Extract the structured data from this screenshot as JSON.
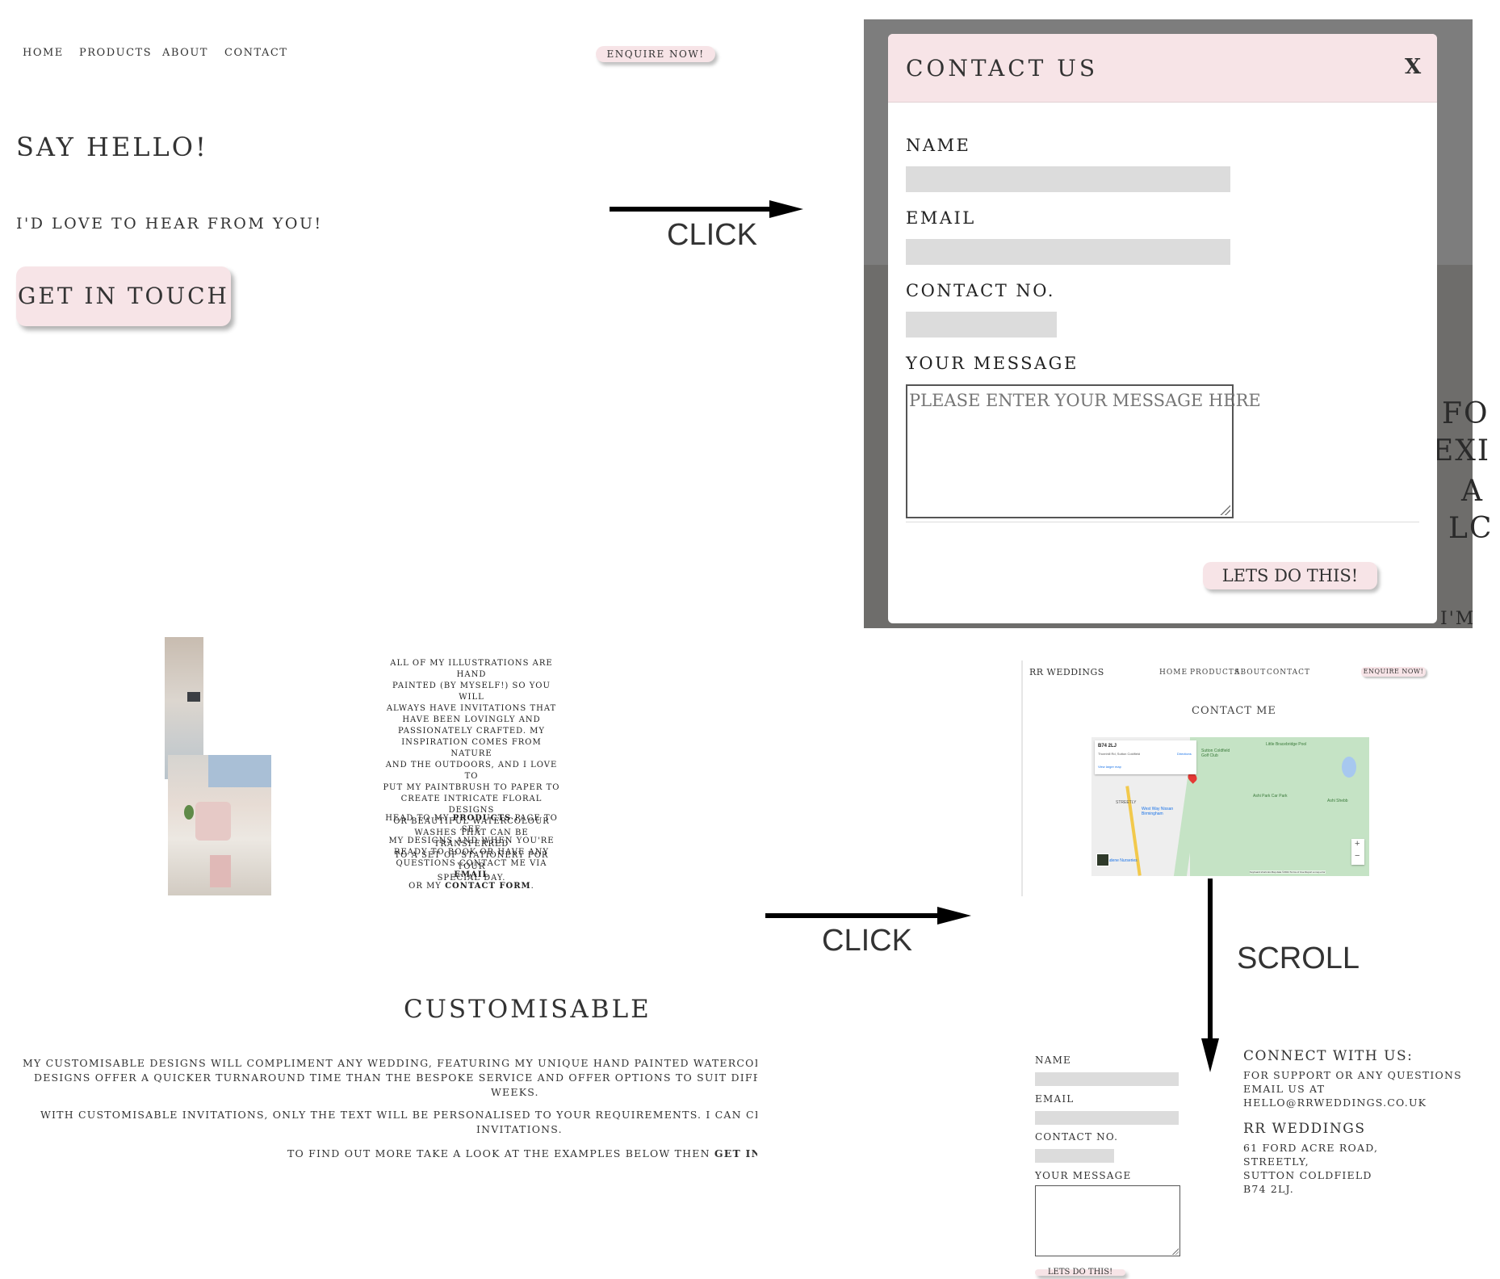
{
  "panel1": {
    "nav": [
      "HOME",
      "PRODUCTS",
      "ABOUT",
      "CONTACT"
    ],
    "enquire_button": "ENQUIRE NOW!",
    "heading": "SAY HELLO!",
    "subheading": "I'D LOVE TO HEAR FROM YOU!",
    "cta_button": "GET IN TOUCH"
  },
  "annotations": {
    "click_1": "CLICK",
    "click_2": "CLICK",
    "scroll": "SCROLL"
  },
  "modal": {
    "title": "CONTACT US",
    "close": "X",
    "name_label": "NAME",
    "email_label": "EMAIL",
    "phone_label": "CONTACT NO.",
    "message_label": "YOUR MESSAGE",
    "message_placeholder": "PLEASE ENTER YOUR MESSAGE HERE",
    "submit": "LETS DO THIS!",
    "background_fragments": [
      "FO",
      "EXI",
      "A",
      "LC",
      "I'M"
    ]
  },
  "panel3": {
    "about_paragraph_1": [
      "ALL OF MY ILLUSTRATIONS ARE HAND",
      "PAINTED (BY MYSELF!) SO YOU WILL",
      "ALWAYS HAVE INVITATIONS THAT",
      "HAVE BEEN LOVINGLY AND",
      "PASSIONATELY CRAFTED. MY",
      "INSPIRATION COMES FROM NATURE",
      "AND THE OUTDOORS, AND I LOVE TO",
      "PUT MY PAINTBRUSH TO PAPER TO",
      "CREATE INTRICATE FLORAL DESIGNS",
      "OR BEAUTIFUL WATERCOLOUR",
      "WASHES THAT CAN BE TRANSFERRED",
      "TO A SET OF STATIONERY FOR YOUR",
      "SPECIAL DAY."
    ],
    "about_paragraph_2": {
      "l1a": "HEAD TO MY ",
      "l1b": "PRODUCTS",
      "l1c": " PAGE TO SEE",
      "l2": "MY DESIGNS AND WHEN YOU'RE",
      "l3": "READY TO BOOK OR HAVE ANY",
      "l4a": "QUESTIONS CONTACT ME VIA ",
      "l4b": "EMAIL",
      "l5a": "OR MY ",
      "l5b": "CONTACT FORM",
      "l5c": "."
    },
    "section_title": "CUSTOMISABLE",
    "custom_lines": [
      "MY CUSTOMISABLE DESIGNS WILL COMPLIMENT ANY WEDDING, FEATURING MY UNIQUE HAND PAINTED WATERCOLOUR ILLUSTRATION",
      "DESIGNS OFFER A QUICKER TURNAROUND TIME THAN THE BESPOKE SERVICE AND OFFER OPTIONS TO SUIT DIFFERENT BUDGETS. T",
      "WEEKS.",
      "WITH CUSTOMISABLE INVITATIONS, ONLY THE TEXT WILL BE PERSONALISED TO YOUR REQUIREMENTS. I CAN CHANGE ENVELOPE (",
      "INVITATIONS."
    ],
    "find_out_a": "TO FIND OUT MORE TAKE A LOOK AT THE EXAMPLES BELOW THEN ",
    "find_out_b": "GET IN TOUCH",
    "find_out_c": "."
  },
  "panel4": {
    "brand": "RR WEDDINGS",
    "nav": [
      "HOME",
      "PRODUCTS",
      "ABOUT",
      "CONTACT"
    ],
    "enquire_button": "ENQUIRE NOW!",
    "title": "CONTACT ME",
    "map": {
      "postcode": "B74 2LJ",
      "address_line": "Thornhill Rd, Sutton Coldfield",
      "directions": "Directions",
      "larger_map": "View larger map",
      "labels": [
        "Little Bracebridge Pool",
        "Sutton Coldfield Golf Club",
        "Ashi Park Car Park",
        "Ashi Shebb",
        "STREETLY",
        "West Way Nissan Birmingham",
        "adene Nurseries"
      ],
      "zoom_in": "+",
      "zoom_out": "−",
      "attribution": "Keyboard shortcuts   Map data ©2021   Terms of Use   Report a map error"
    },
    "form": {
      "name_label": "NAME",
      "email_label": "EMAIL",
      "phone_label": "CONTACT NO.",
      "message_label": "YOUR MESSAGE",
      "submit": "LETS DO THIS!"
    },
    "connect": {
      "title": "CONNECT WITH US:",
      "lines": [
        "FOR SUPPORT OR ANY QUESTIONS",
        "EMAIL US AT",
        "HELLO@RRWEDDINGS.CO.UK"
      ],
      "company": "RR WEDDINGS",
      "address": [
        "61 FORD ACRE ROAD,",
        "STREETLY,",
        "SUTTON COLDFIELD",
        "B74 2LJ."
      ]
    }
  },
  "colors": {
    "accent_pink": "#f7e4e7",
    "overlay_grey": "#7d7d7d",
    "field_grey": "#dcdcdc",
    "map_green": "#c5e3c5"
  }
}
